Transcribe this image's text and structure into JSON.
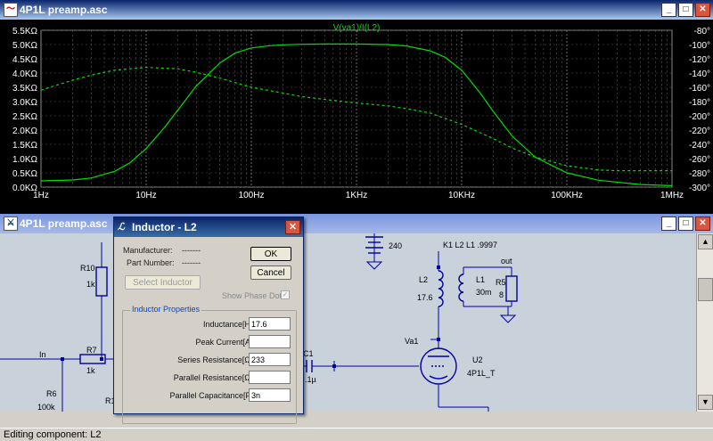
{
  "top_window": {
    "title": "4P1L preamp.asc"
  },
  "bottom_window": {
    "title": "4P1L preamp.asc"
  },
  "status": {
    "text": "Editing component: L2"
  },
  "chart_data": {
    "type": "line",
    "title": "V(va1)/I(L2)",
    "x_scale": "log",
    "x_ticks": [
      "1Hz",
      "10Hz",
      "100Hz",
      "1KHz",
      "10KHz",
      "100KHz",
      "1MHz"
    ],
    "x_values": [
      1,
      10,
      100,
      1000,
      10000,
      100000,
      1000000
    ],
    "y_left_ticks": [
      "0.0KΩ",
      "0.5KΩ",
      "1.0KΩ",
      "1.5KΩ",
      "2.0KΩ",
      "2.5KΩ",
      "3.0KΩ",
      "3.5KΩ",
      "4.0KΩ",
      "4.5KΩ",
      "5.0KΩ",
      "5.5KΩ"
    ],
    "y_right_ticks": [
      "-300°",
      "-280°",
      "-260°",
      "-240°",
      "-220°",
      "-200°",
      "-180°",
      "-160°",
      "-140°",
      "-120°",
      "-100°",
      "-80°"
    ],
    "ylim_left": [
      0,
      5.5
    ],
    "ylim_right": [
      -300,
      -80
    ],
    "grid": true,
    "color": "#00e000",
    "series": [
      {
        "style": "solid",
        "axis": "left",
        "x": [
          1,
          2,
          3,
          5,
          7,
          10,
          15,
          20,
          30,
          50,
          70,
          100,
          150,
          200,
          300,
          500,
          1000,
          2000,
          3000,
          5000,
          7000,
          10000,
          15000,
          20000,
          30000,
          50000,
          100000,
          200000,
          500000,
          1000000
        ],
        "y": [
          0.22,
          0.25,
          0.32,
          0.55,
          0.85,
          1.35,
          2.1,
          2.7,
          3.55,
          4.35,
          4.7,
          4.88,
          4.96,
          4.99,
          5.01,
          5.02,
          5.02,
          5.0,
          4.95,
          4.78,
          4.55,
          4.1,
          3.3,
          2.65,
          1.8,
          1.05,
          0.5,
          0.24,
          0.09,
          0.05
        ]
      },
      {
        "style": "dashed",
        "axis": "right",
        "x": [
          1,
          2,
          3,
          5,
          10,
          20,
          30,
          50,
          100,
          200,
          300,
          500,
          1000,
          2000,
          3000,
          5000,
          10000,
          20000,
          30000,
          50000,
          100000,
          200000,
          300000,
          500000,
          1000000
        ],
        "y": [
          -164,
          -150,
          -143,
          -136,
          -132,
          -134,
          -139,
          -147,
          -160,
          -168,
          -173,
          -177,
          -182,
          -186,
          -190,
          -196,
          -212,
          -232,
          -245,
          -258,
          -270,
          -276,
          -277,
          -277,
          -277
        ]
      }
    ]
  },
  "schematic": {
    "labels": {
      "r10": "R10",
      "r10_val": "1k",
      "r7": "R7",
      "r7_val": "1k",
      "r6": "R6",
      "r6_val": "100k",
      "r1": "R1",
      "in": "In",
      "v240": "240",
      "k1": "K1 L2 L1 .9997",
      "out": "out",
      "l2": "L2",
      "l2_val": "17.6",
      "l1": "L1",
      "l1_val": "30m",
      "r5": "R5",
      "r5_val": "8",
      "va1": "Va1",
      "u2": "U2",
      "u2_val": "4P1L_T",
      "c1": "C1",
      "c1_val": ".1µ"
    }
  },
  "dialog": {
    "title": "Inductor - L2",
    "manufacturer_label": "Manufacturer:",
    "manufacturer_value": "-------",
    "part_label": "Part Number:",
    "part_value": "-------",
    "ok": "OK",
    "cancel": "Cancel",
    "select_inductor": "Select Inductor",
    "show_phase_dot": "Show Phase Dot",
    "group_title": "Inductor Properties",
    "fields": [
      {
        "label": "Inductance[H]:",
        "value": "17.6"
      },
      {
        "label": "Peak Current[A]:",
        "value": ""
      },
      {
        "label": "Series Resistance[Ω]:",
        "value": "233"
      },
      {
        "label": "Parallel Resistance[Ω]:",
        "value": ""
      },
      {
        "label": "Parallel Capacitance[F]:",
        "value": "3n"
      }
    ]
  }
}
